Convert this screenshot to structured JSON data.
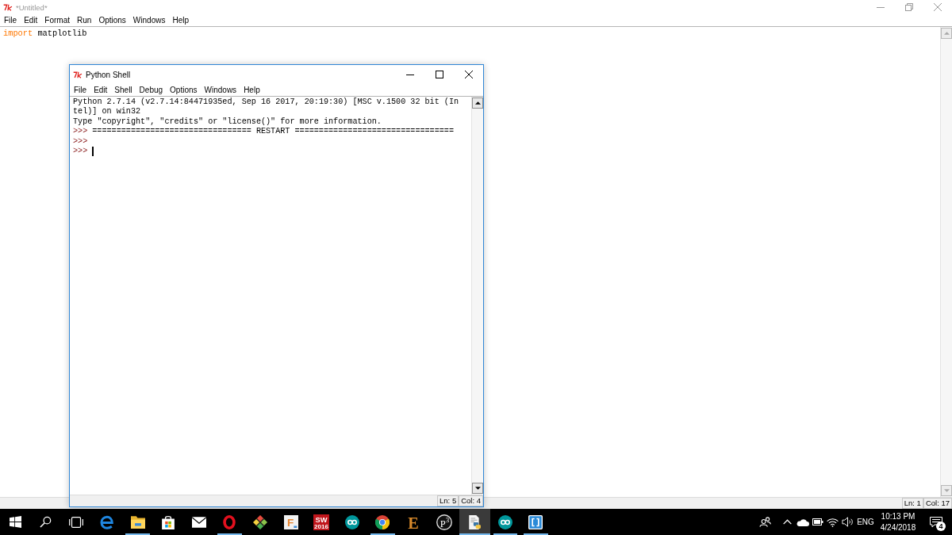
{
  "editor_window": {
    "title": "*Untitled*",
    "focused": false,
    "maximized": true,
    "menu": [
      "File",
      "Edit",
      "Format",
      "Run",
      "Options",
      "Windows",
      "Help"
    ],
    "code_lines": [
      {
        "tokens": [
          {
            "kind": "keyword",
            "text": "import"
          },
          {
            "kind": "plain",
            "text": " matplotlib"
          }
        ]
      }
    ],
    "status_bar": {
      "line": "Ln: 1",
      "column": "Col: 17"
    }
  },
  "shell_window": {
    "title": "Python Shell",
    "focused": true,
    "maximized": false,
    "menu": [
      "File",
      "Edit",
      "Shell",
      "Debug",
      "Options",
      "Windows",
      "Help"
    ],
    "lines": [
      {
        "text": "Python 2.7.14 (v2.7.14:84471935ed, Sep 16 2017, 20:19:30) [MSC v.1500 32 bit (In",
        "cursor": false
      },
      {
        "text": "tel)] on win32",
        "cursor": false
      },
      {
        "text": "Type \"copyright\", \"credits\" or \"license()\" for more information.",
        "cursor": false
      },
      {
        "prompt": ">>>",
        "text": "================================= RESTART =================================",
        "cursor": false
      },
      {
        "prompt": ">>>",
        "cursor": false
      },
      {
        "prompt": ">>>",
        "cursor": true
      }
    ],
    "status_bar": {
      "line": "Ln: 5",
      "column": "Col: 4"
    }
  },
  "taskbar": {
    "buttons": [
      {
        "kind": "start"
      },
      {
        "kind": "search"
      },
      {
        "kind": "task_view"
      }
    ],
    "apps": [
      {
        "kind": "edge",
        "running": false,
        "selected": false
      },
      {
        "kind": "folder",
        "running": true,
        "selected": false
      },
      {
        "kind": "store",
        "running": false,
        "selected": false
      },
      {
        "kind": "mail",
        "running": false,
        "selected": false
      },
      {
        "kind": "opera",
        "running": true,
        "selected": false
      },
      {
        "kind": "diamond",
        "running": false,
        "selected": false
      },
      {
        "kind": "letter_tile",
        "glyph": "F",
        "running": false,
        "selected": false
      },
      {
        "kind": "red_tile",
        "glyph": "SW",
        "caption": "2016",
        "running": false,
        "selected": false
      },
      {
        "kind": "infinity",
        "running": false,
        "selected": false
      },
      {
        "kind": "chrome",
        "running": true,
        "selected": false
      },
      {
        "kind": "wood_letter",
        "glyph": "E",
        "running": false,
        "selected": false
      },
      {
        "kind": "circle_letter",
        "glyph": "P",
        "caption": "3",
        "running": false,
        "selected": false
      },
      {
        "kind": "document",
        "running": true,
        "selected": true
      },
      {
        "kind": "infinity",
        "running": true,
        "selected": false
      },
      {
        "kind": "brackets",
        "running": true,
        "selected": false
      }
    ],
    "tray": {
      "icons": [
        {
          "kind": "people"
        },
        {
          "kind": "chevron"
        },
        {
          "kind": "cloud"
        },
        {
          "kind": "battery"
        },
        {
          "kind": "wifi"
        },
        {
          "kind": "volume"
        }
      ],
      "language": "ENG",
      "time": "10:13 PM",
      "date": "4/24/2018",
      "notifications": "4"
    }
  }
}
